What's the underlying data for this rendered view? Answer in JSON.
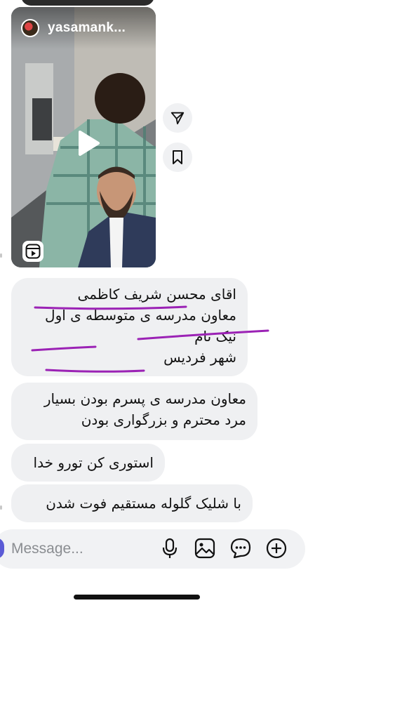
{
  "reel": {
    "username": "yasamank..."
  },
  "messages": [
    {
      "lines": [
        "اقای محسن شریف کاظمی",
        "معاون مدرسه ی متوسطه ی اول",
        "نیک نام",
        "شهر فردیس"
      ]
    },
    {
      "lines": [
        "معاون مدرسه ی پسرم بودن بسیار",
        "مرد محترم و بزرگواری بودن"
      ]
    },
    {
      "lines": [
        "استوری کن تورو خدا"
      ]
    },
    {
      "lines": [
        "با شلیک گلوله مستقیم فوت شدن"
      ]
    }
  ],
  "composer": {
    "placeholder": "Message..."
  },
  "icons": {
    "share": "send-icon",
    "save": "bookmark-icon",
    "mic": "microphone-icon",
    "gallery": "image-icon",
    "sticker": "sticker-icon",
    "add": "plus-icon",
    "play": "play-icon",
    "reel": "reel-icon"
  },
  "colors": {
    "bubble": "#eff0f2",
    "annotation": "#9b22b5",
    "accent": "#5b5bd6"
  }
}
